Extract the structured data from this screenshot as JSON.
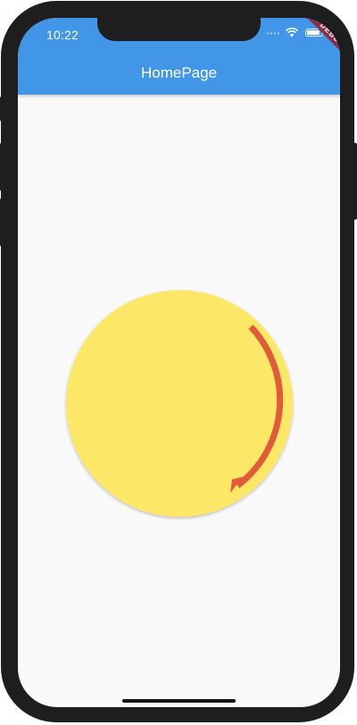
{
  "status_bar": {
    "time": "10:22"
  },
  "app_bar": {
    "title": "HomePage"
  },
  "debug_banner": {
    "label": "DEBUG"
  },
  "canvas": {
    "circle_color": "#fce866",
    "arrow_color": "#e15a3a",
    "appbar_color": "#4196e8",
    "background_color": "#f9f9f9"
  }
}
